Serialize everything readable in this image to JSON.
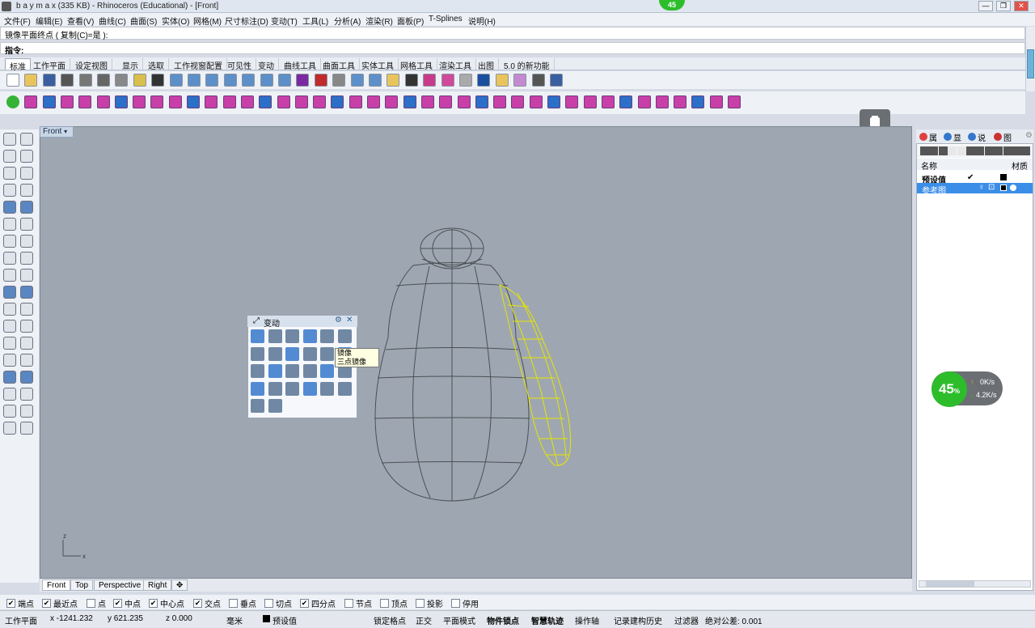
{
  "window": {
    "title": "b a y m a x (335 KB) - Rhinoceros (Educational) - [Front]",
    "controls": [
      "—",
      "❐",
      "✕"
    ],
    "badge": "45"
  },
  "menu": [
    "文件(F)",
    "编辑(E)",
    "查看(V)",
    "曲线(C)",
    "曲面(S)",
    "实体(O)",
    "网格(M)",
    "尺寸标注(D)",
    "变动(T)",
    "工具(L)",
    "分析(A)",
    "渲染(R)",
    "面板(P)",
    "T-Splines",
    "说明(H)"
  ],
  "command_history": "镜像平面终点 ( 复制(C)=是 ):",
  "command_prompt": "指令:",
  "toolbar_tabs": [
    "标准",
    "工作平面",
    "设定视图",
    "显示",
    "选取",
    "工作视窗配置",
    "可见性",
    "变动",
    "曲线工具",
    "曲面工具",
    "实体工具",
    "网格工具",
    "渲染工具",
    "出图",
    "5.0 的新功能"
  ],
  "viewport": {
    "name": "Front",
    "axis_labels": {
      "z": "z",
      "x": "x"
    }
  },
  "float_toolbar": {
    "title": "变动",
    "tooltip_lines": [
      "镜像",
      "三点镜像"
    ]
  },
  "right_panel": {
    "tabs": [
      "属",
      "显",
      "说",
      "图"
    ],
    "columns": {
      "name": "名称",
      "material": "材质"
    },
    "layers": [
      {
        "name": "预设值",
        "current": "✔",
        "selected": false
      },
      {
        "name": "参考图",
        "current": "",
        "selected": true
      }
    ]
  },
  "viewport_tabs": [
    "Front",
    "Top",
    "Perspective",
    "Right",
    "✥"
  ],
  "osnaps": [
    {
      "label": "端点",
      "checked": true
    },
    {
      "label": "最近点",
      "checked": true
    },
    {
      "label": "点",
      "checked": false
    },
    {
      "label": "中点",
      "checked": true
    },
    {
      "label": "中心点",
      "checked": true
    },
    {
      "label": "交点",
      "checked": true
    },
    {
      "label": "垂点",
      "checked": false
    },
    {
      "label": "切点",
      "checked": false
    },
    {
      "label": "四分点",
      "checked": true
    },
    {
      "label": "节点",
      "checked": false
    },
    {
      "label": "顶点",
      "checked": false
    },
    {
      "label": "投影",
      "checked": false
    },
    {
      "label": "停用",
      "checked": false
    }
  ],
  "status": {
    "cplane": "工作平面",
    "x": "x -1241.232",
    "y": "y 621.235",
    "z": "z 0.000",
    "units": "毫米",
    "layer": "预设值",
    "toggles": [
      "锁定格点",
      "正交",
      "平面模式",
      "物件锁点",
      "智慧轨迹",
      "操作轴",
      "记录建构历史",
      "过滤器"
    ],
    "tolerance": "绝对公差: 0.001"
  },
  "net_widget": {
    "percent": "45",
    "percent_sign": "%",
    "up": "0K/s",
    "down": "4.2K/s"
  },
  "colors": {
    "selection": "#e5e500",
    "wire": "#4b4f55",
    "viewport_bg": "#9ea7b1",
    "accent": "#3b8ee8"
  }
}
